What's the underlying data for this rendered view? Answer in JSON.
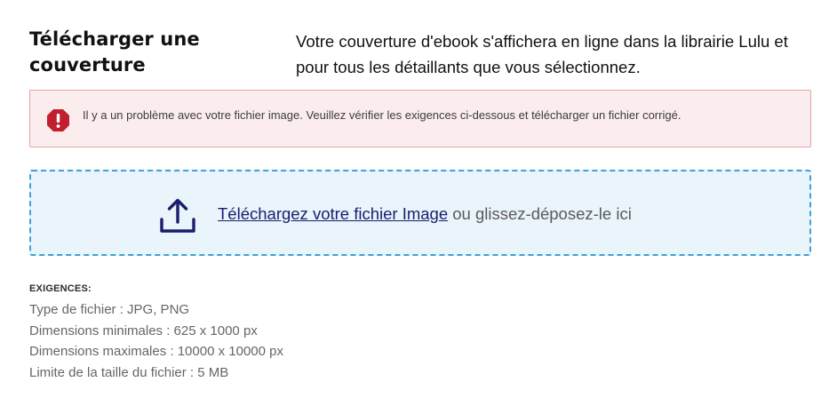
{
  "header": {
    "title": "Télécharger une couverture",
    "description": "Votre couverture d'ebook s'affichera en ligne dans la librairie Lulu et pour tous les détaillants que vous sélectionnez."
  },
  "alert": {
    "icon": "error-octagon-icon",
    "color": "#c0202e",
    "message": "Il y a un problème avec votre fichier image. Veuillez vérifier les exigences ci-dessous et télécharger un fichier corrigé."
  },
  "dropzone": {
    "icon": "upload-icon",
    "link_label": "Téléchargez votre fichier Image",
    "rest_label": " ou glissez-déposez-le ici"
  },
  "requirements": {
    "heading": "EXIGENCES:",
    "items": [
      "Type de fichier : JPG, PNG",
      "Dimensions minimales : 625 x 1000 px",
      "Dimensions maximales : 10000 x 10000 px",
      "Limite de la taille du fichier : 5 MB"
    ]
  }
}
